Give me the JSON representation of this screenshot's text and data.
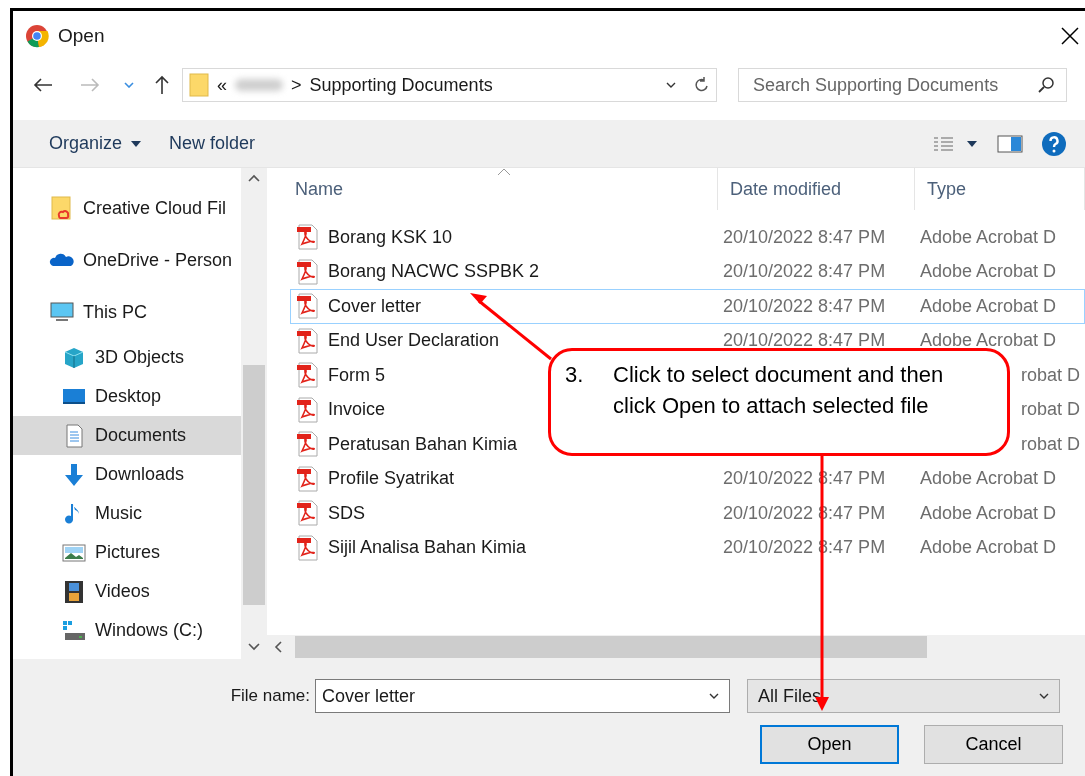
{
  "window": {
    "title": "Open"
  },
  "address_bar": {
    "prefix": "«",
    "separator": ">",
    "current": "Supporting Documents"
  },
  "search": {
    "placeholder": "Search Supporting Documents"
  },
  "toolbar": {
    "buttons": [
      {
        "label": "Organize",
        "dropdown": true
      },
      {
        "label": "New folder",
        "dropdown": false
      }
    ]
  },
  "sidebar": {
    "items": [
      {
        "label": "Creative Cloud Fil",
        "kind": "cloud-folder",
        "selected": false
      },
      {
        "label": "OneDrive - Person",
        "kind": "cloud",
        "selected": false
      },
      {
        "label": "This PC",
        "kind": "computer",
        "selected": false,
        "children": [
          {
            "label": "3D Objects",
            "kind": "cube",
            "selected": false
          },
          {
            "label": "Desktop",
            "kind": "desktop",
            "selected": false
          },
          {
            "label": "Documents",
            "kind": "documents",
            "selected": true
          },
          {
            "label": "Downloads",
            "kind": "downloads",
            "selected": false
          },
          {
            "label": "Music",
            "kind": "music",
            "selected": false
          },
          {
            "label": "Pictures",
            "kind": "pictures",
            "selected": false
          },
          {
            "label": "Videos",
            "kind": "videos",
            "selected": false
          },
          {
            "label": "Windows (C:)",
            "kind": "drive",
            "selected": false
          }
        ]
      }
    ]
  },
  "table": {
    "columns": [
      "Name",
      "Date modified",
      "Type"
    ],
    "rows": [
      {
        "name": "Borang KSK 10",
        "date": "20/10/2022 8:47 PM",
        "type": "Adobe Acrobat D",
        "selected": false,
        "kind": "full"
      },
      {
        "name": "Borang NACWC SSPBK 2",
        "date": "20/10/2022 8:47 PM",
        "type": "Adobe Acrobat D",
        "selected": false,
        "kind": "full"
      },
      {
        "name": "Cover letter",
        "date": "20/10/2022 8:47 PM",
        "type": "Adobe Acrobat D",
        "selected": true,
        "kind": "full"
      },
      {
        "name": "End User Declaration",
        "date": "20/10/2022 8:47 PM",
        "type": "Adobe Acrobat D",
        "selected": false,
        "kind": "full"
      },
      {
        "name": "Form 5",
        "type": "robat D",
        "selected": false,
        "kind": "covered"
      },
      {
        "name": "Invoice",
        "type": "robat D",
        "selected": false,
        "kind": "covered"
      },
      {
        "name": "Peratusan Bahan Kimia",
        "type": "robat D",
        "selected": false,
        "kind": "covered"
      },
      {
        "name": "Profile Syatrikat",
        "date": "20/10/2022 8:47 PM",
        "type": "Adobe Acrobat D",
        "selected": false,
        "kind": "full"
      },
      {
        "name": "SDS",
        "date": "20/10/2022 8:47 PM",
        "type": "Adobe Acrobat D",
        "selected": false,
        "kind": "full"
      },
      {
        "name": "Sijil Analisa Bahan Kimia",
        "date": "20/10/2022 8:47 PM",
        "type": "Adobe Acrobat D",
        "selected": false,
        "kind": "full"
      }
    ]
  },
  "file_name": {
    "label": "File name:",
    "value": "Cover letter"
  },
  "file_type": {
    "value": "All Files"
  },
  "buttons": [
    {
      "label": "Open",
      "default": true
    },
    {
      "label": "Cancel",
      "default": false
    }
  ],
  "callout": {
    "number": "3.",
    "text": "Click to select document and then click Open to attach selected file"
  }
}
